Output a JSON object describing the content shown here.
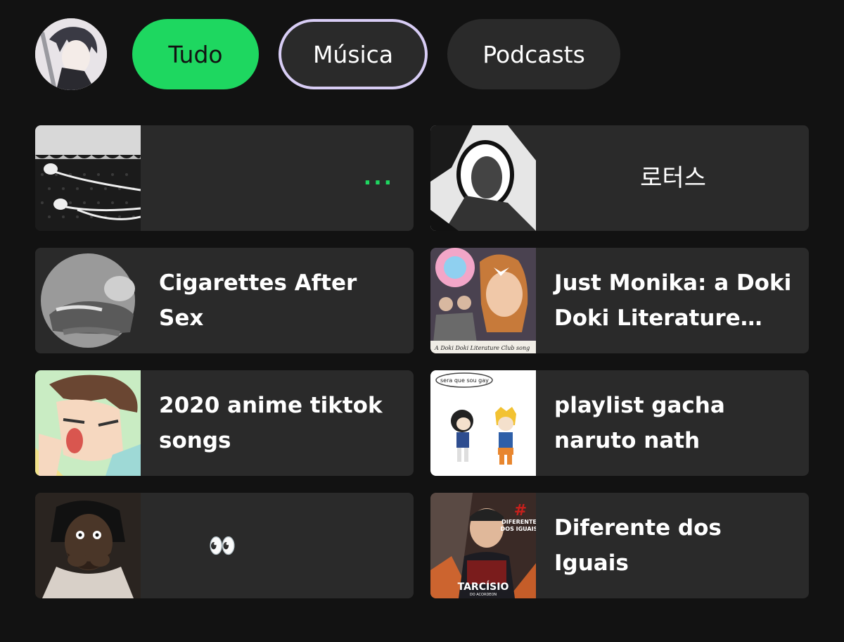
{
  "filters": {
    "tudo": "Tudo",
    "musica": "Música",
    "podcasts": "Podcasts"
  },
  "colors": {
    "accent": "#1ed760",
    "background": "#121212",
    "card": "#2a2a2a",
    "selected_border": "#d8cdf5"
  },
  "shortcuts": [
    {
      "title": "...",
      "thumb": "earphones-lace-photo"
    },
    {
      "title": "로터스",
      "thumb": "manga-panel"
    },
    {
      "title": "Cigarettes After Sex",
      "thumb": "artist-photo-grayscale"
    },
    {
      "title": "Just Monika: a Doki Doki Literature Club song",
      "thumb": "doki-doki-cover"
    },
    {
      "title": "2020 anime tiktok songs",
      "thumb": "anime-character-face"
    },
    {
      "title": "playlist gacha naruto nath",
      "thumb": "gacha-naruto-characters"
    },
    {
      "title": "👀",
      "thumb": "reaction-photo"
    },
    {
      "title": "Diferente dos Iguais",
      "thumb": "tarcisio-album-cover"
    }
  ],
  "thumb_text": {
    "doki": "A Doki Doki Literature Club song",
    "gacha_bubble": "sera que sou gay",
    "tarcisio_name": "TARCÍSIO",
    "tarcisio_sub": "DO ACORDEON",
    "tarcisio_title1": "DIFERENTE",
    "tarcisio_title2": "DOS IGUAIS"
  }
}
